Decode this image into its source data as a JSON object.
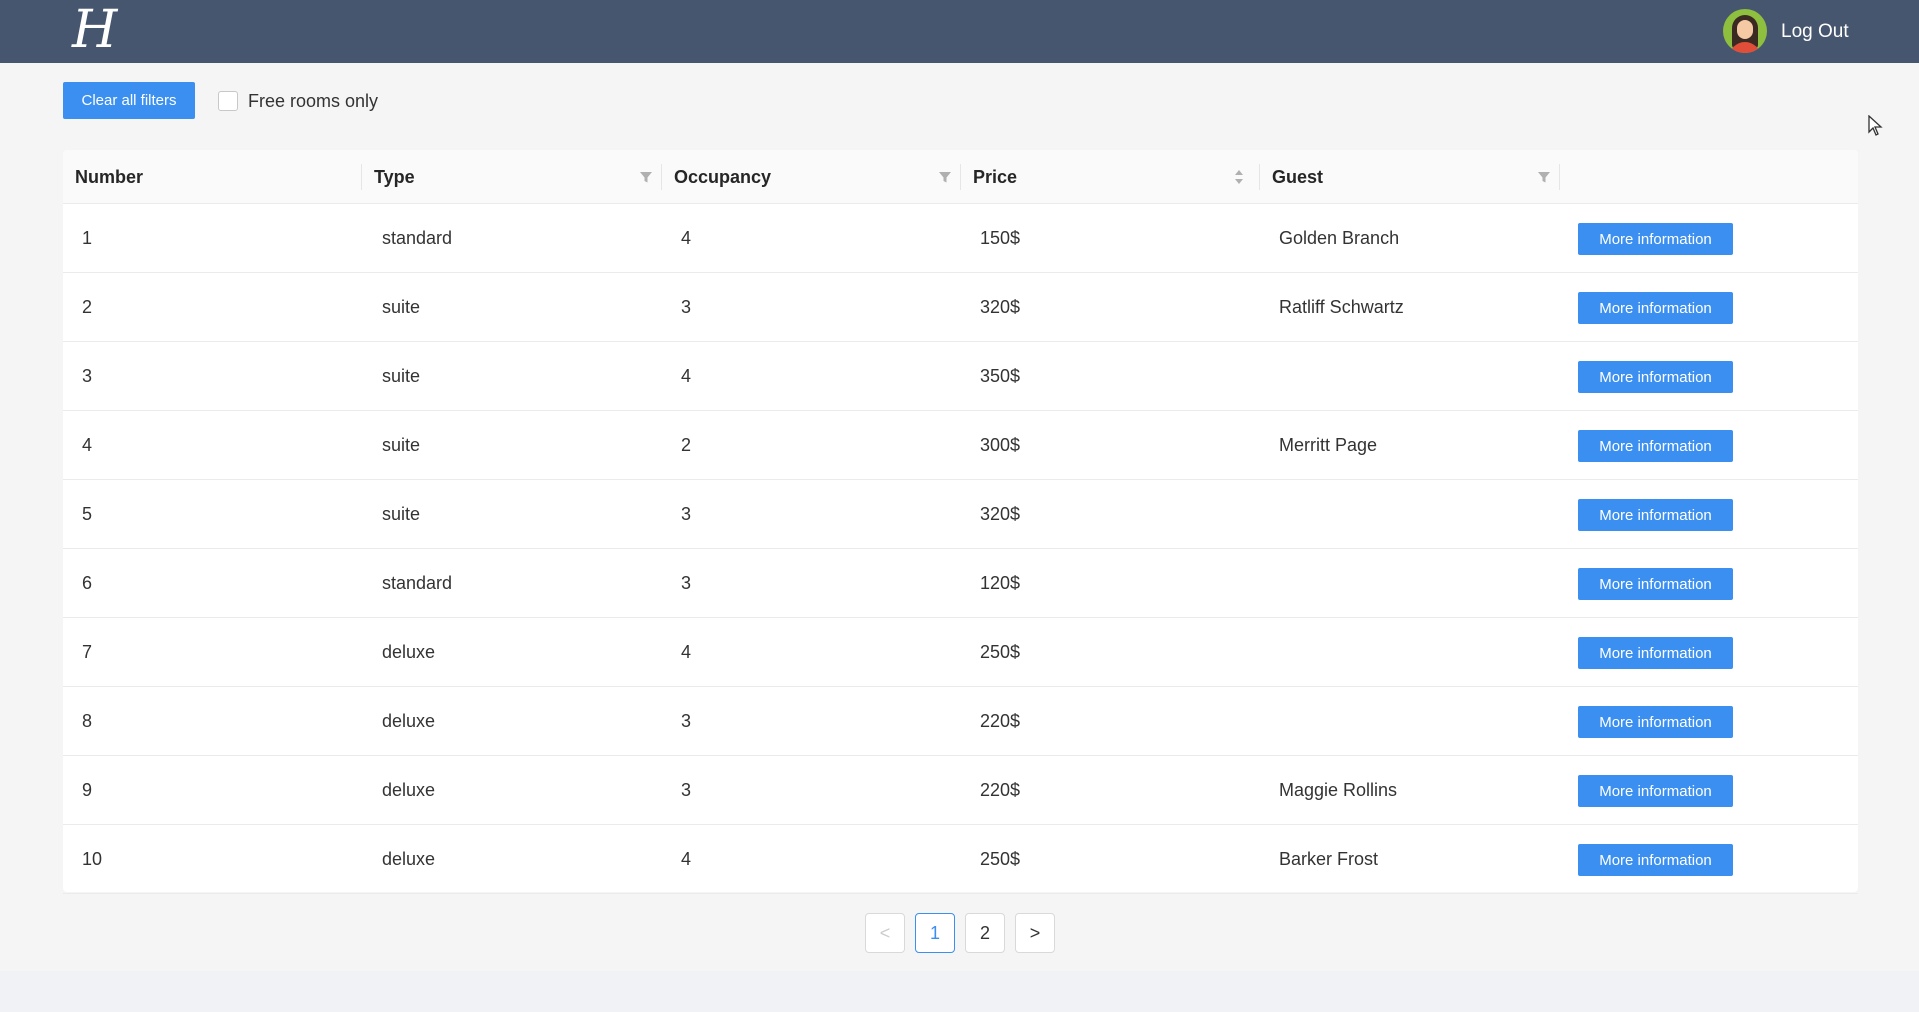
{
  "header": {
    "logo_letter": "H",
    "logout_label": "Log Out"
  },
  "filters": {
    "clear_label": "Clear all filters",
    "free_rooms_label": "Free rooms only",
    "free_rooms_checked": false
  },
  "table": {
    "columns": [
      "Number",
      "Type",
      "Occupancy",
      "Price",
      "Guest"
    ],
    "rows": [
      {
        "number": "1",
        "type": "standard",
        "occupancy": "4",
        "price": "150$",
        "guest": "Golden Branch",
        "action": "More information"
      },
      {
        "number": "2",
        "type": "suite",
        "occupancy": "3",
        "price": "320$",
        "guest": "Ratliff Schwartz",
        "action": "More information"
      },
      {
        "number": "3",
        "type": "suite",
        "occupancy": "4",
        "price": "350$",
        "guest": "",
        "action": "More information"
      },
      {
        "number": "4",
        "type": "suite",
        "occupancy": "2",
        "price": "300$",
        "guest": "Merritt Page",
        "action": "More information"
      },
      {
        "number": "5",
        "type": "suite",
        "occupancy": "3",
        "price": "320$",
        "guest": "",
        "action": "More information"
      },
      {
        "number": "6",
        "type": "standard",
        "occupancy": "3",
        "price": "120$",
        "guest": "",
        "action": "More information"
      },
      {
        "number": "7",
        "type": "deluxe",
        "occupancy": "4",
        "price": "250$",
        "guest": "",
        "action": "More information"
      },
      {
        "number": "8",
        "type": "deluxe",
        "occupancy": "3",
        "price": "220$",
        "guest": "",
        "action": "More information"
      },
      {
        "number": "9",
        "type": "deluxe",
        "occupancy": "3",
        "price": "220$",
        "guest": "Maggie Rollins",
        "action": "More information"
      },
      {
        "number": "10",
        "type": "deluxe",
        "occupancy": "4",
        "price": "250$",
        "guest": "Barker Frost",
        "action": "More information"
      }
    ]
  },
  "pagination": {
    "prev": "<",
    "pages": [
      "1",
      "2"
    ],
    "current": "1",
    "next": ">"
  },
  "colors": {
    "header_bg": "#47566f",
    "accent": "#3a8ff0"
  }
}
